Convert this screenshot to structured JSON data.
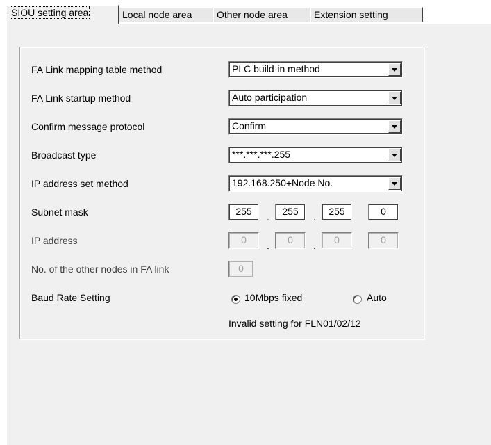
{
  "tabs": [
    {
      "label": "SIOU setting area",
      "active": true
    },
    {
      "label": "Local node area",
      "active": false
    },
    {
      "label": "Other node area",
      "active": false
    },
    {
      "label": "Extension setting",
      "active": false
    }
  ],
  "form": {
    "mapping_method": {
      "label": "FA Link mapping table method",
      "value": "PLC build-in method"
    },
    "startup_method": {
      "label": "FA Link startup method",
      "value": "Auto participation"
    },
    "confirm_protocol": {
      "label": "Confirm message protocol",
      "value": "Confirm"
    },
    "broadcast_type": {
      "label": "Broadcast type",
      "value": "***.***.***.255"
    },
    "ip_set_method": {
      "label": "IP address set method",
      "value": "192.168.250+Node No."
    },
    "subnet_mask": {
      "label": "Subnet mask",
      "octets": [
        "255",
        "255",
        "255",
        "0"
      ]
    },
    "ip_address": {
      "label": "IP address",
      "octets": [
        "0",
        "0",
        "0",
        "0"
      ]
    },
    "other_nodes": {
      "label": "No. of the other nodes in FA link",
      "value": "0"
    },
    "baud_rate": {
      "label": "Baud Rate Setting",
      "options": [
        "10Mbps fixed",
        "Auto"
      ],
      "selected": "10Mbps fixed",
      "note": "Invalid setting for FLN01/02/12"
    },
    "octet_separator": "."
  },
  "colors": {
    "panel_bg": "#f0f0f0",
    "disabled_text": "#a0a0a0"
  }
}
